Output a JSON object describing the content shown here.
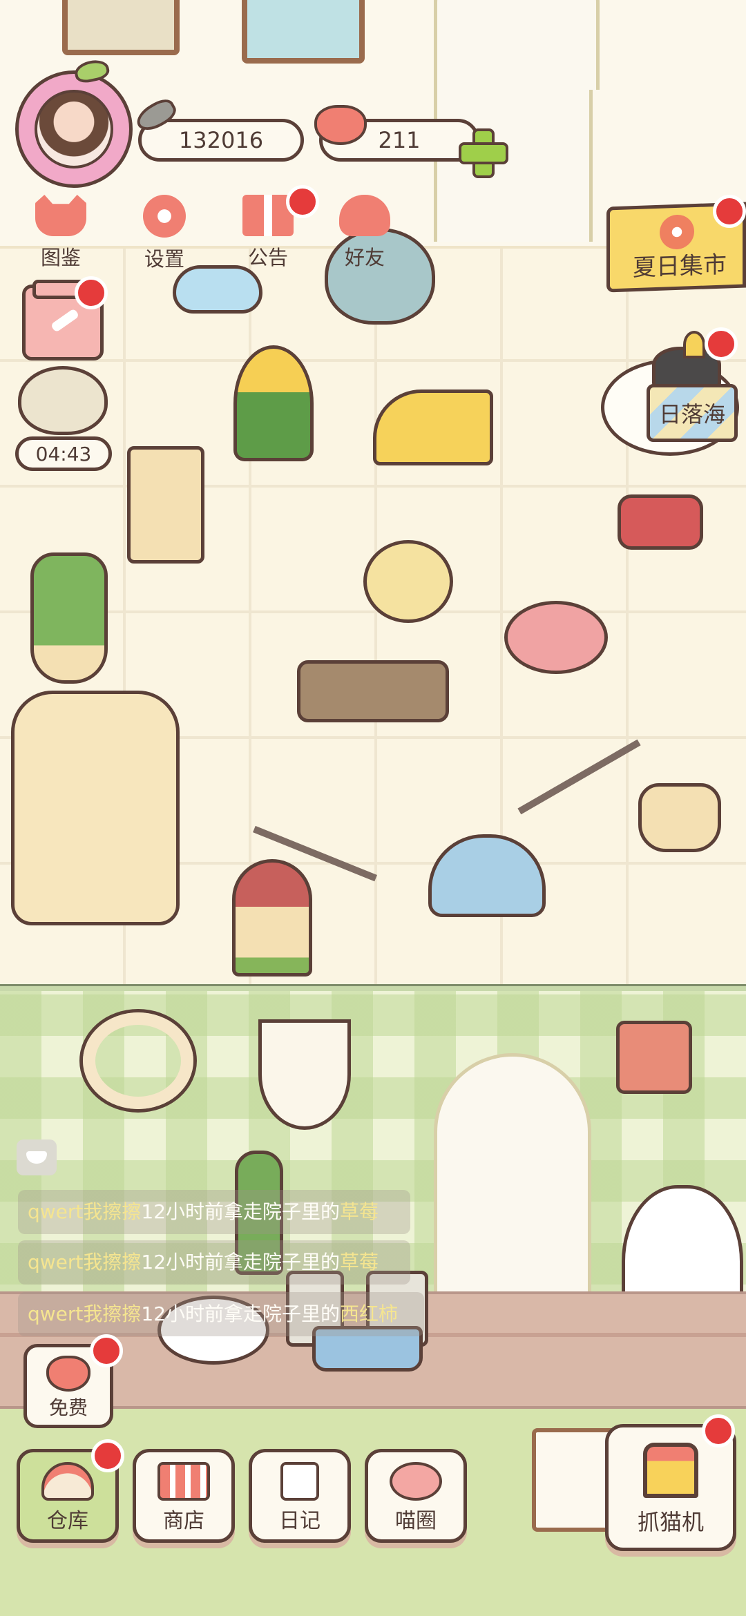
{
  "hud": {
    "fish_count": "132016",
    "heart_count": "211",
    "menu": [
      {
        "label": "图鉴",
        "icon": "cat-book-icon"
      },
      {
        "label": "设置",
        "icon": "gear-icon"
      },
      {
        "label": "公告",
        "icon": "gift-icon"
      },
      {
        "label": "好友",
        "icon": "friends-icon"
      }
    ],
    "timer": "04:43"
  },
  "signs": {
    "summer_market": "夏日集市",
    "sunset_sea": "日落海"
  },
  "chat": [
    {
      "user": "qwert我擦擦",
      "text": "12小时前拿走院子里的",
      "item": "草莓"
    },
    {
      "user": "qwert我擦擦",
      "text": "12小时前拿走院子里的",
      "item": "草莓"
    },
    {
      "user": "qwert我擦擦",
      "text": "12小时前拿走院子里的",
      "item": "西红柿"
    }
  ],
  "bottom": {
    "free": "免费",
    "nav": [
      {
        "label": "仓库",
        "icon": "warehouse-icon"
      },
      {
        "label": "商店",
        "icon": "shop-icon"
      },
      {
        "label": "日记",
        "icon": "diary-icon"
      },
      {
        "label": "喵圈",
        "icon": "cat-planet-icon"
      }
    ],
    "claw": "抓猫机"
  },
  "colors": {
    "accent": "#f07f72",
    "outline": "#5b4038",
    "badge": "#e53b3b",
    "wall": "#fbf5e3",
    "yard": "#eef3d6"
  }
}
